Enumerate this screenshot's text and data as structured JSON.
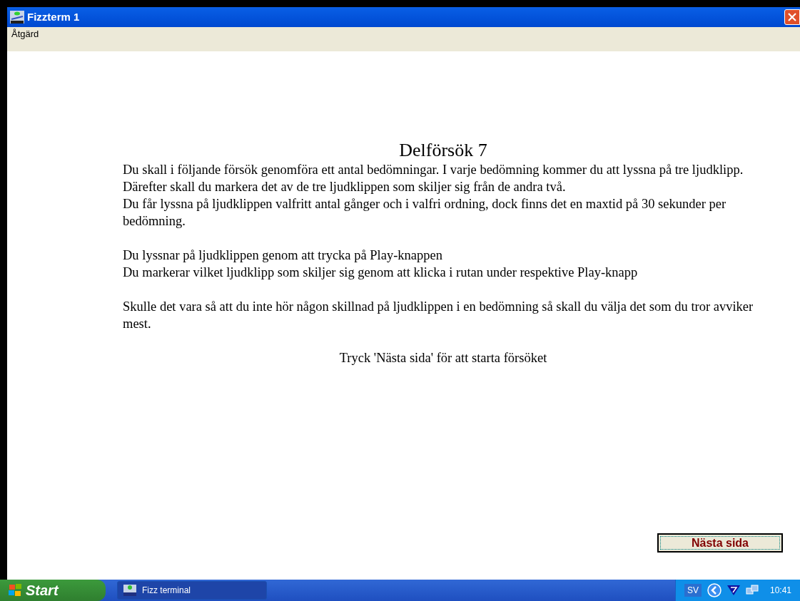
{
  "window": {
    "title": "Fizzterm 1"
  },
  "menu": [
    "Åtgärd"
  ],
  "heading": "Delförsök 7",
  "paragraph_groups": [
    [
      "Du skall i följande försök genomföra ett antal bedömningar. I varje bedömning kommer du att lyssna på tre ljudklipp.",
      "Därefter skall du markera det av de tre ljudklippen som skiljer sig från de andra två.",
      "Du får lyssna på ljudklippen valfritt antal gånger och i valfri ordning, dock finns det en maxtid på 30 sekunder per bedömning."
    ],
    [
      "Du lyssnar på ljudklippen genom att trycka på Play-knappen",
      "Du markerar vilket ljudklipp som skiljer sig genom att klicka i rutan under respektive Play-knapp"
    ],
    [
      "Skulle det vara så att du inte hör någon skillnad på ljudklippen i en bedömning så skall du välja det som du tror avviker mest."
    ]
  ],
  "instruction": "Tryck 'Nästa sida' för att starta försöket",
  "next_button": "Nästa sida",
  "taskbar": {
    "start": "Start",
    "tasks": [
      {
        "label": "Fizz terminal",
        "selected": true
      }
    ],
    "language": "SV",
    "clock": "10:41"
  }
}
